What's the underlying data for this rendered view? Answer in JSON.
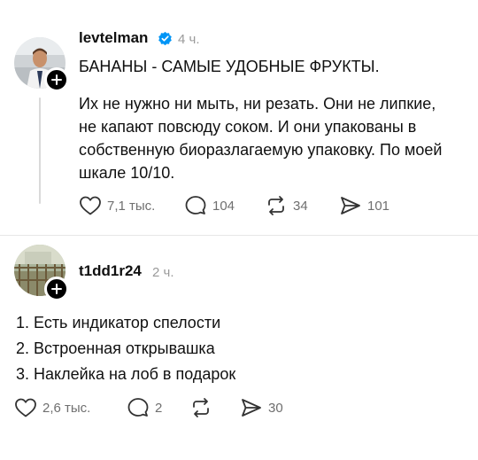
{
  "post": {
    "username": "levtelman",
    "time": "4 ч.",
    "headline": "БАНАНЫ - САМЫЕ УДОБНЫЕ ФРУКТЫ.",
    "body_lines": [
      "Их не нужно ни мыть, ни резать. Они не липкие,",
      "не капают повсюду соком. И они упакованы в",
      "собственную биоразлагаемую упаковку. По моей",
      "шкале 10/10."
    ],
    "actions": {
      "likes": "7,1 тыс.",
      "comments": "104",
      "reposts": "34",
      "shares": "101"
    }
  },
  "reply": {
    "username": "t1dd1r24",
    "time": "2 ч.",
    "lines": [
      "1. Есть индикатор спелости",
      "2. Встроенная открывашка",
      "3. Наклейка на лоб в подарок"
    ],
    "actions": {
      "likes": "2,6 тыс.",
      "comments": "2",
      "shares": "30"
    }
  },
  "colors": {
    "verified": "#0095f6",
    "muted": "#9a9a9a",
    "text": "#101010"
  }
}
